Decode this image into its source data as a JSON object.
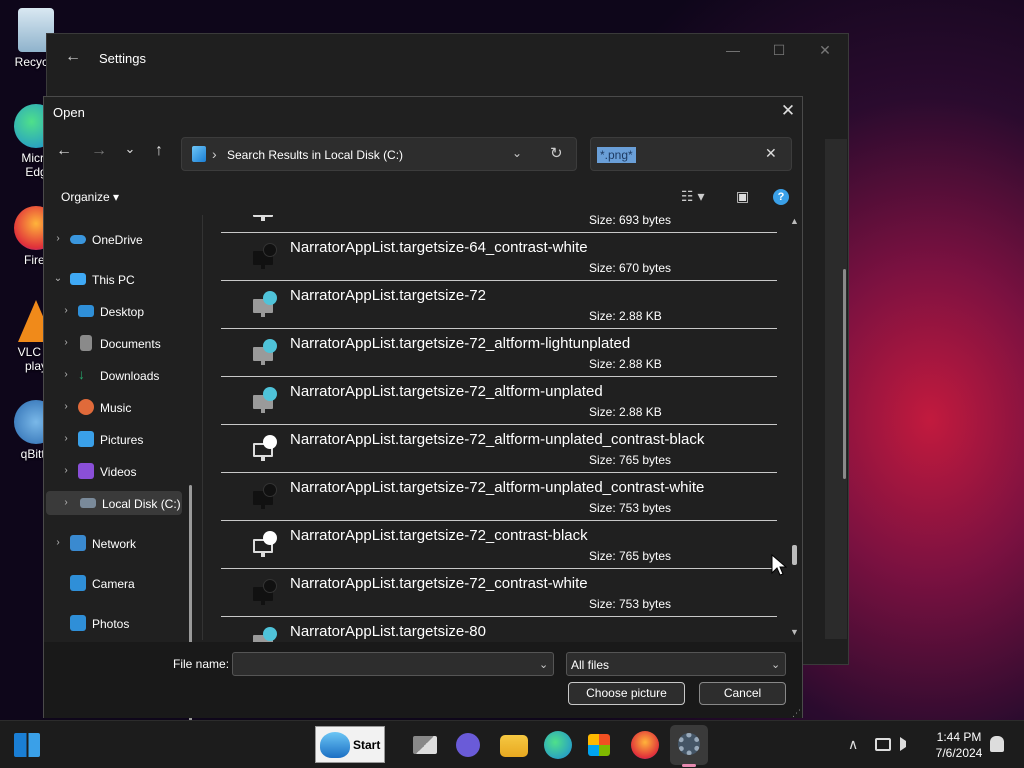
{
  "desktop": {
    "icons": [
      {
        "label": "Recycle"
      },
      {
        "label": "Micro\nEdg"
      },
      {
        "label": "Firef"
      },
      {
        "label": "VLC m\nplay"
      },
      {
        "label": "qBitto"
      }
    ]
  },
  "settings_window": {
    "title": "Settings",
    "back_glyph": "←",
    "minimize_glyph": "—",
    "maximize_glyph": "☐",
    "close_glyph": "✕"
  },
  "dialog": {
    "title": "Open",
    "close_glyph": "✕",
    "nav": {
      "back": "←",
      "forward": "→",
      "recent": "⌄",
      "up": "↑"
    },
    "address": {
      "separator": "›",
      "path": "Search Results in Local Disk (C:)",
      "dropdown": "⌄",
      "refresh": "↻"
    },
    "search": {
      "value": "*.png*",
      "clear": "✕"
    },
    "toolbar": {
      "organize": "Organize ▾",
      "view": "☷ ▾",
      "preview": "▣",
      "help": "?"
    },
    "nav_pane": [
      {
        "label": "OneDrive",
        "chev": "›",
        "icon": "onedrive-icon",
        "color": "#3a96dd"
      },
      {
        "label": "This PC",
        "chev": "⌄",
        "icon": "computer-icon",
        "color": "#3fa9f5"
      },
      {
        "label": "Desktop",
        "chev": "›",
        "icon": "desktop-folder-icon",
        "color": "#2f8fd8"
      },
      {
        "label": "Documents",
        "chev": "›",
        "icon": "documents-icon",
        "color": "#8a8a8a"
      },
      {
        "label": "Downloads",
        "chev": "›",
        "icon": "downloads-icon",
        "color": "#27a36a"
      },
      {
        "label": "Music",
        "chev": "›",
        "icon": "music-icon",
        "color": "#e06a3a"
      },
      {
        "label": "Pictures",
        "chev": "›",
        "icon": "pictures-icon",
        "color": "#3aa0e8"
      },
      {
        "label": "Videos",
        "chev": "›",
        "icon": "videos-icon",
        "color": "#8a4fd8"
      },
      {
        "label": "Local Disk (C:)",
        "chev": "›",
        "icon": "local-disk-icon",
        "color": "#7a8a9a"
      },
      {
        "label": "Network",
        "chev": "›",
        "icon": "network-icon",
        "color": "#3a8ad0"
      },
      {
        "label": "Camera",
        "chev": "",
        "icon": "camera-folder-icon",
        "color": "#2f8fd8"
      },
      {
        "label": "Photos",
        "chev": "",
        "icon": "photos-folder-icon",
        "color": "#2f8fd8"
      }
    ],
    "files": [
      {
        "name": "",
        "size": "Size: 693 bytes",
        "variant": "white"
      },
      {
        "name": "NarratorAppList.targetsize-64_contrast-white",
        "size": "Size: 670 bytes",
        "variant": "dark"
      },
      {
        "name": "NarratorAppList.targetsize-72",
        "size": "Size: 2.88 KB",
        "variant": "color"
      },
      {
        "name": "NarratorAppList.targetsize-72_altform-lightunplated",
        "size": "Size: 2.88 KB",
        "variant": "color"
      },
      {
        "name": "NarratorAppList.targetsize-72_altform-unplated",
        "size": "Size: 2.88 KB",
        "variant": "color"
      },
      {
        "name": "NarratorAppList.targetsize-72_altform-unplated_contrast-black",
        "size": "Size: 765 bytes",
        "variant": "white"
      },
      {
        "name": "NarratorAppList.targetsize-72_altform-unplated_contrast-white",
        "size": "Size: 753 bytes",
        "variant": "dark"
      },
      {
        "name": "NarratorAppList.targetsize-72_contrast-black",
        "size": "Size: 765 bytes",
        "variant": "white"
      },
      {
        "name": "NarratorAppList.targetsize-72_contrast-white",
        "size": "Size: 753 bytes",
        "variant": "dark"
      },
      {
        "name": "NarratorAppList.targetsize-80",
        "size": "",
        "variant": "color"
      }
    ],
    "file_name_label": "File name:",
    "file_name_value": "",
    "file_type": "All files",
    "dropdown_glyph": "⌄",
    "choose_button": "Choose picture",
    "cancel_button": "Cancel"
  },
  "taskbar": {
    "start_label": "Start",
    "time": "1:44 PM",
    "date": "7/6/2024",
    "tray": {
      "chevron": "∧"
    }
  },
  "colors": {
    "accent": "#3aa0e8",
    "bubble_teal": "#4fc3d9"
  }
}
